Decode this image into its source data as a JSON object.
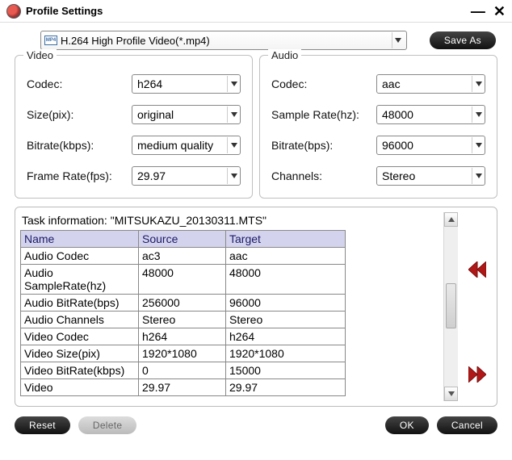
{
  "window": {
    "title": "Profile Settings"
  },
  "toolbar": {
    "profile": "H.264 High Profile Video(*.mp4)",
    "save_as": "Save As"
  },
  "video": {
    "legend": "Video",
    "codec_label": "Codec:",
    "codec": "h264",
    "size_label": "Size(pix):",
    "size": "original",
    "bitrate_label": "Bitrate(kbps):",
    "bitrate": "medium quality",
    "framerate_label": "Frame Rate(fps):",
    "framerate": "29.97"
  },
  "audio": {
    "legend": "Audio",
    "codec_label": "Codec:",
    "codec": "aac",
    "samplerate_label": "Sample Rate(hz):",
    "samplerate": "48000",
    "bitrate_label": "Bitrate(bps):",
    "bitrate": "96000",
    "channels_label": "Channels:",
    "channels": "Stereo"
  },
  "task": {
    "header_prefix": "Task information: ",
    "filename": "\"MITSUKAZU_20130311.MTS\"",
    "columns": {
      "name": "Name",
      "source": "Source",
      "target": "Target"
    },
    "rows": [
      {
        "name": "Audio Codec",
        "source": "ac3",
        "target": "aac"
      },
      {
        "name": "Audio SampleRate(hz)",
        "source": "48000",
        "target": "48000"
      },
      {
        "name": "Audio BitRate(bps)",
        "source": "256000",
        "target": "96000"
      },
      {
        "name": "Audio Channels",
        "source": "Stereo",
        "target": "Stereo"
      },
      {
        "name": "Video Codec",
        "source": "h264",
        "target": "h264"
      },
      {
        "name": "Video Size(pix)",
        "source": "1920*1080",
        "target": "1920*1080"
      },
      {
        "name": "Video BitRate(kbps)",
        "source": "0",
        "target": "15000"
      },
      {
        "name": "Video",
        "source": "29.97",
        "target": "29.97"
      }
    ]
  },
  "footer": {
    "reset": "Reset",
    "delete": "Delete",
    "ok": "OK",
    "cancel": "Cancel"
  }
}
